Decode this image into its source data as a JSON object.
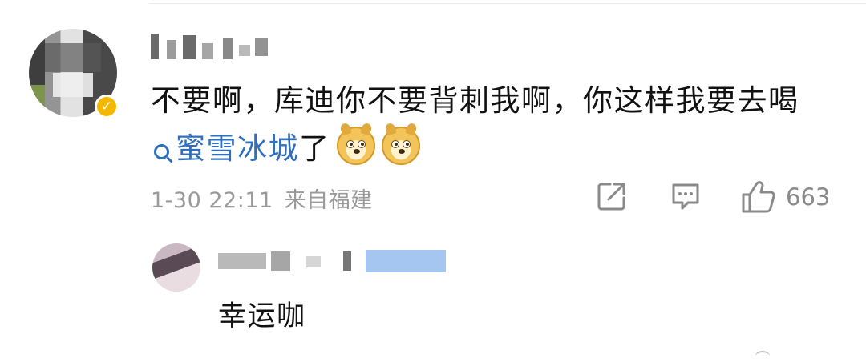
{
  "comment": {
    "text_part1": "不要啊，库迪你不要背刺我啊，你这样我要去喝",
    "topic_link": "蜜雪冰城",
    "text_part2": "了",
    "emojis": [
      "doge-emoji",
      "doge-emoji"
    ],
    "timestamp": "1-30 22:11",
    "location": "来自福建",
    "like_count": "663"
  },
  "reply": {
    "text": "幸运咖"
  },
  "colors": {
    "link": "#2f6fbd",
    "meta_text": "#9a9a9a",
    "verified_badge": "#f5b800"
  },
  "icons": {
    "share": "share-icon",
    "comment": "comment-icon",
    "like": "thumbs-up-icon",
    "search": "search-icon",
    "verified": "verified-badge-icon"
  }
}
